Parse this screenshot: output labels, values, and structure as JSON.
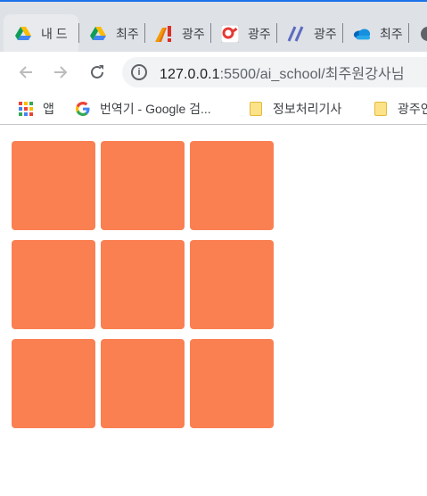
{
  "browser": {
    "tabs": [
      {
        "title": "내 드",
        "icon": "google-drive-icon"
      },
      {
        "title": "최주",
        "icon": "google-drive-icon"
      },
      {
        "title": "광주",
        "icon": "ai-logo-icon"
      },
      {
        "title": "광주",
        "icon": "red-badge-icon"
      },
      {
        "title": "광주",
        "icon": "slash-logo-icon"
      },
      {
        "title": "최주",
        "icon": "onedrive-cloud-icon"
      }
    ],
    "url_host": "127.0.0.1",
    "url_rest": ":5500/ai_school/최주원강사님",
    "bookmarks": [
      {
        "label": "앱",
        "icon": "apps-grid-icon"
      },
      {
        "label": "번역기 - Google 검...",
        "icon": "google-g-icon"
      },
      {
        "label": "정보처리기사",
        "icon": "folder-icon"
      },
      {
        "label": "광주인",
        "icon": "folder-icon"
      }
    ]
  },
  "page": {
    "grid": {
      "rows": 3,
      "columns": 3,
      "box_color": "#fa8052"
    }
  },
  "colors": {
    "accent": "#1a73e8",
    "tabstrip": "#dee1e6",
    "box": "#fa8052"
  }
}
